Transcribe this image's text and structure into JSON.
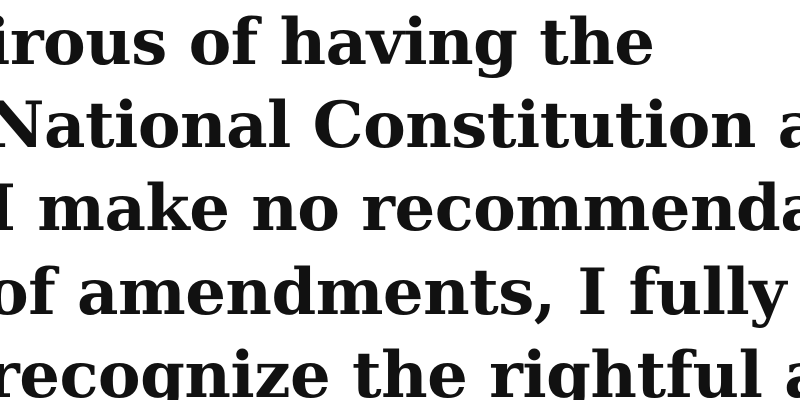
{
  "document": {
    "lines": [
      "irous of having the",
      "National Constitution a",
      "I make no recommenda",
      "of amendments, I fully",
      "recognize the rightful au"
    ]
  }
}
